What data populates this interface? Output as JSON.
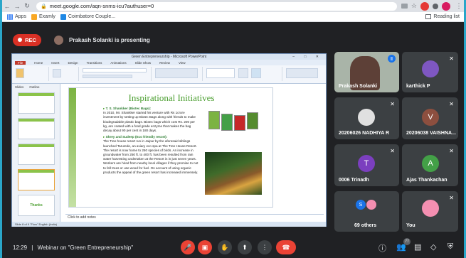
{
  "browser": {
    "url": "meet.google.com/aqn-snms-icu?authuser=0",
    "bookmarks": [
      {
        "label": "Apps"
      },
      {
        "label": "Examly"
      },
      {
        "label": "Coimbatore Couple..."
      }
    ],
    "reading_list": "Reading list"
  },
  "meet": {
    "rec_label": "REC",
    "presenting_text": "Prakash Solanki is presenting",
    "meeting_time": "12:29",
    "meeting_separator": "|",
    "meeting_title": "Webinar on \"Green Entrepreneurship\"",
    "people_badge": "77"
  },
  "ppt": {
    "window_title": "Green Entrepreneurship - Microsoft PowerPoint",
    "tabs": [
      "File",
      "Home",
      "Insert",
      "Design",
      "Transitions",
      "Animations",
      "Slide Show",
      "Review",
      "View"
    ],
    "panel_tabs": [
      "Slides",
      "Outline"
    ],
    "slide_title": "Inspirational Initiatives",
    "bullet1_heading": "T. S. Shankker (Biotec Bags):",
    "bullet1_text": "In 2010, Mr. Shankker started his venture with Rs 1crore investment by setting up Biotec Bags along with friends to make biodegradable plastic bags. Biotec bags which cost Rs. 200 per kg, are coated with a food grade enzyme that makes the bag decay about 90 per cent in 180 days.",
    "bullet2_heading": "Shrey and Sudeep (Eco friendly resort):",
    "bullet2_text": "The Tree house resort run in Jaipur by the aforesaid siblings launched Tarurede, an aviary eco spa at The Tree House Resort. The resort is now home to 250 species of birds. An increase in groundwater from 250 ft. to 400 ft. has been resulted from rain water harvesting undertaken at the Resort in in just seven years. Workers are hired from nearby local villages if they promise to not to fell trees or use wood for fuel. On account of using organic products the appeal of the green resort has increased immensely.",
    "thumb_thanks": "Thanks",
    "notes_placeholder": "Click to add notes",
    "status_text": "Slide 8 of 9   \"Flow\"   English (India)"
  },
  "participants": [
    {
      "name": "Prakash Solanki"
    },
    {
      "name": "karthick P"
    },
    {
      "name": "20206026 NADHIYA R"
    },
    {
      "name": "20206038 VAISHNA...",
      "initial": "V"
    },
    {
      "name": "0006 Trinadh",
      "initial": "T"
    },
    {
      "name": "Ajas Thankachan",
      "initial": "A"
    },
    {
      "name": "69 others",
      "initial": "S"
    },
    {
      "name": "You"
    }
  ],
  "colors": {
    "accent_red": "#ea4335",
    "rec_red": "#d93025",
    "tile_bg": "#3c4043",
    "v_avatar": "#8d4f3f",
    "t_avatar": "#7b3fbf",
    "a_avatar": "#43a047",
    "s_avatar": "#1a73e8",
    "slide_green": "#4a9e2f"
  }
}
